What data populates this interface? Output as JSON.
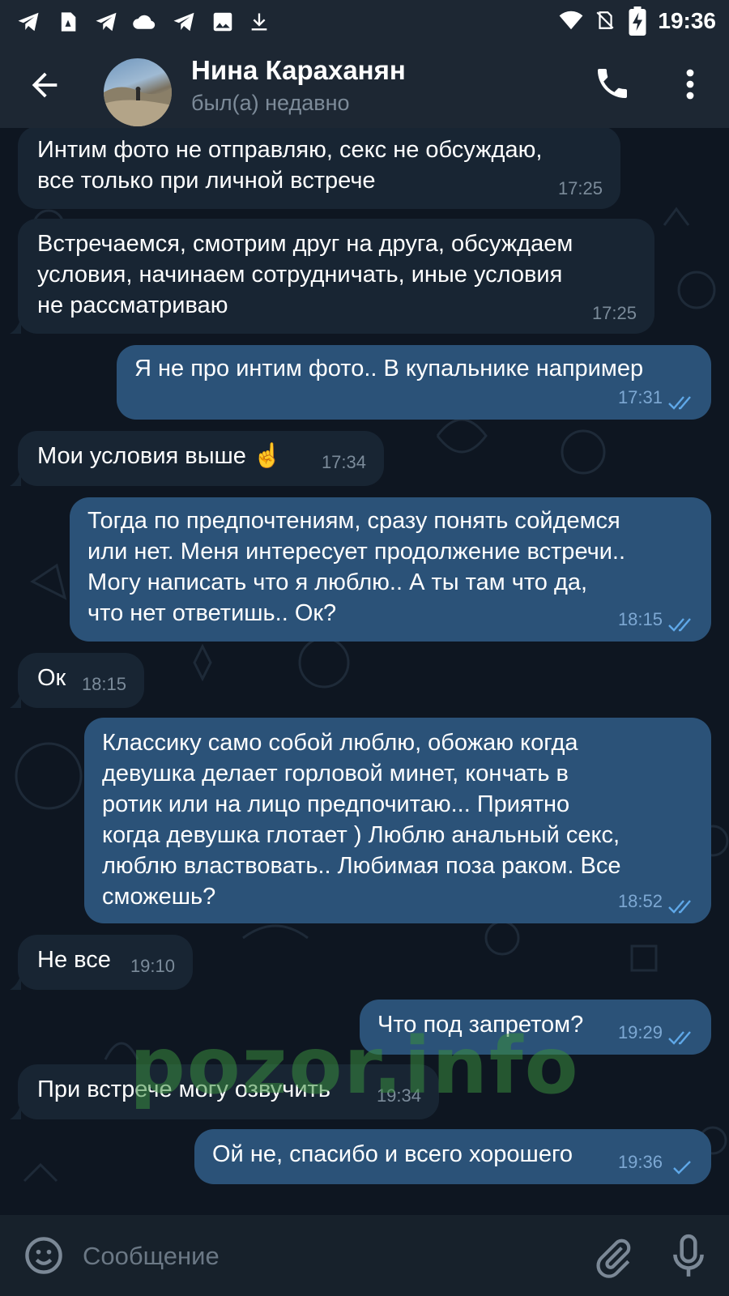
{
  "status_bar": {
    "time": "19:36",
    "left_icons": [
      "telegram-icon",
      "file-icon",
      "telegram-icon",
      "cloud-icon",
      "telegram-icon",
      "image-icon",
      "download-icon"
    ],
    "right_icons": [
      "wifi-icon",
      "no-sim-icon",
      "battery-charging-icon"
    ]
  },
  "header": {
    "contact_name": "Нина Караханян",
    "contact_status": "был(а) недавно"
  },
  "messages": [
    {
      "direction": "in",
      "text": "Интим фото не отправляю, секс не обсуждаю,\nвсе только при личной встрече",
      "time": "17:25"
    },
    {
      "direction": "in",
      "text": "Встречаемся, смотрим друг на друга, обсуждаем\nусловия, начинаем сотрудничать, иные условия\nне рассматриваю",
      "time": "17:25"
    },
    {
      "direction": "out",
      "text": "Я не про интим фото.. В купальнике например",
      "time": "17:31",
      "status": "read"
    },
    {
      "direction": "in",
      "text": "Мои условия выше ☝️",
      "time": "17:34"
    },
    {
      "direction": "out",
      "text": "Тогда по предпочтениям, сразу понять сойдемся\nили нет. Меня интересует продолжение встречи..\nМогу написать что я люблю.. А ты там что да,\nчто нет ответишь.. Ок?",
      "time": "18:15",
      "status": "read"
    },
    {
      "direction": "in",
      "text": "Ок",
      "time": "18:15"
    },
    {
      "direction": "out",
      "text": "Классику само собой люблю, обожаю когда\nдевушка делает горловой минет, кончать в\nротик или на лицо предпочитаю... Приятно\nкогда девушка глотает ) Люблю анальный секс,\nлюблю властвовать.. Любимая поза раком. Все\nсможешь?",
      "time": "18:52",
      "status": "read"
    },
    {
      "direction": "in",
      "text": "Не все",
      "time": "19:10"
    },
    {
      "direction": "out",
      "text": "Что под запретом?",
      "time": "19:29",
      "status": "read"
    },
    {
      "direction": "in",
      "text": "При встрече могу озвучить",
      "time": "19:34"
    },
    {
      "direction": "out",
      "text": "Ой не, спасибо и всего хорошего",
      "time": "19:36",
      "status": "sent"
    }
  ],
  "watermark": "pozor.info",
  "input": {
    "placeholder": "Сообщение"
  },
  "colors": {
    "header_bg": "#1d2733",
    "chat_bg": "#0e1621",
    "incoming_bubble": "#182533",
    "outgoing_bubble": "#2b5278",
    "tick_color": "#5fa8e8",
    "watermark": "#388c3e"
  }
}
